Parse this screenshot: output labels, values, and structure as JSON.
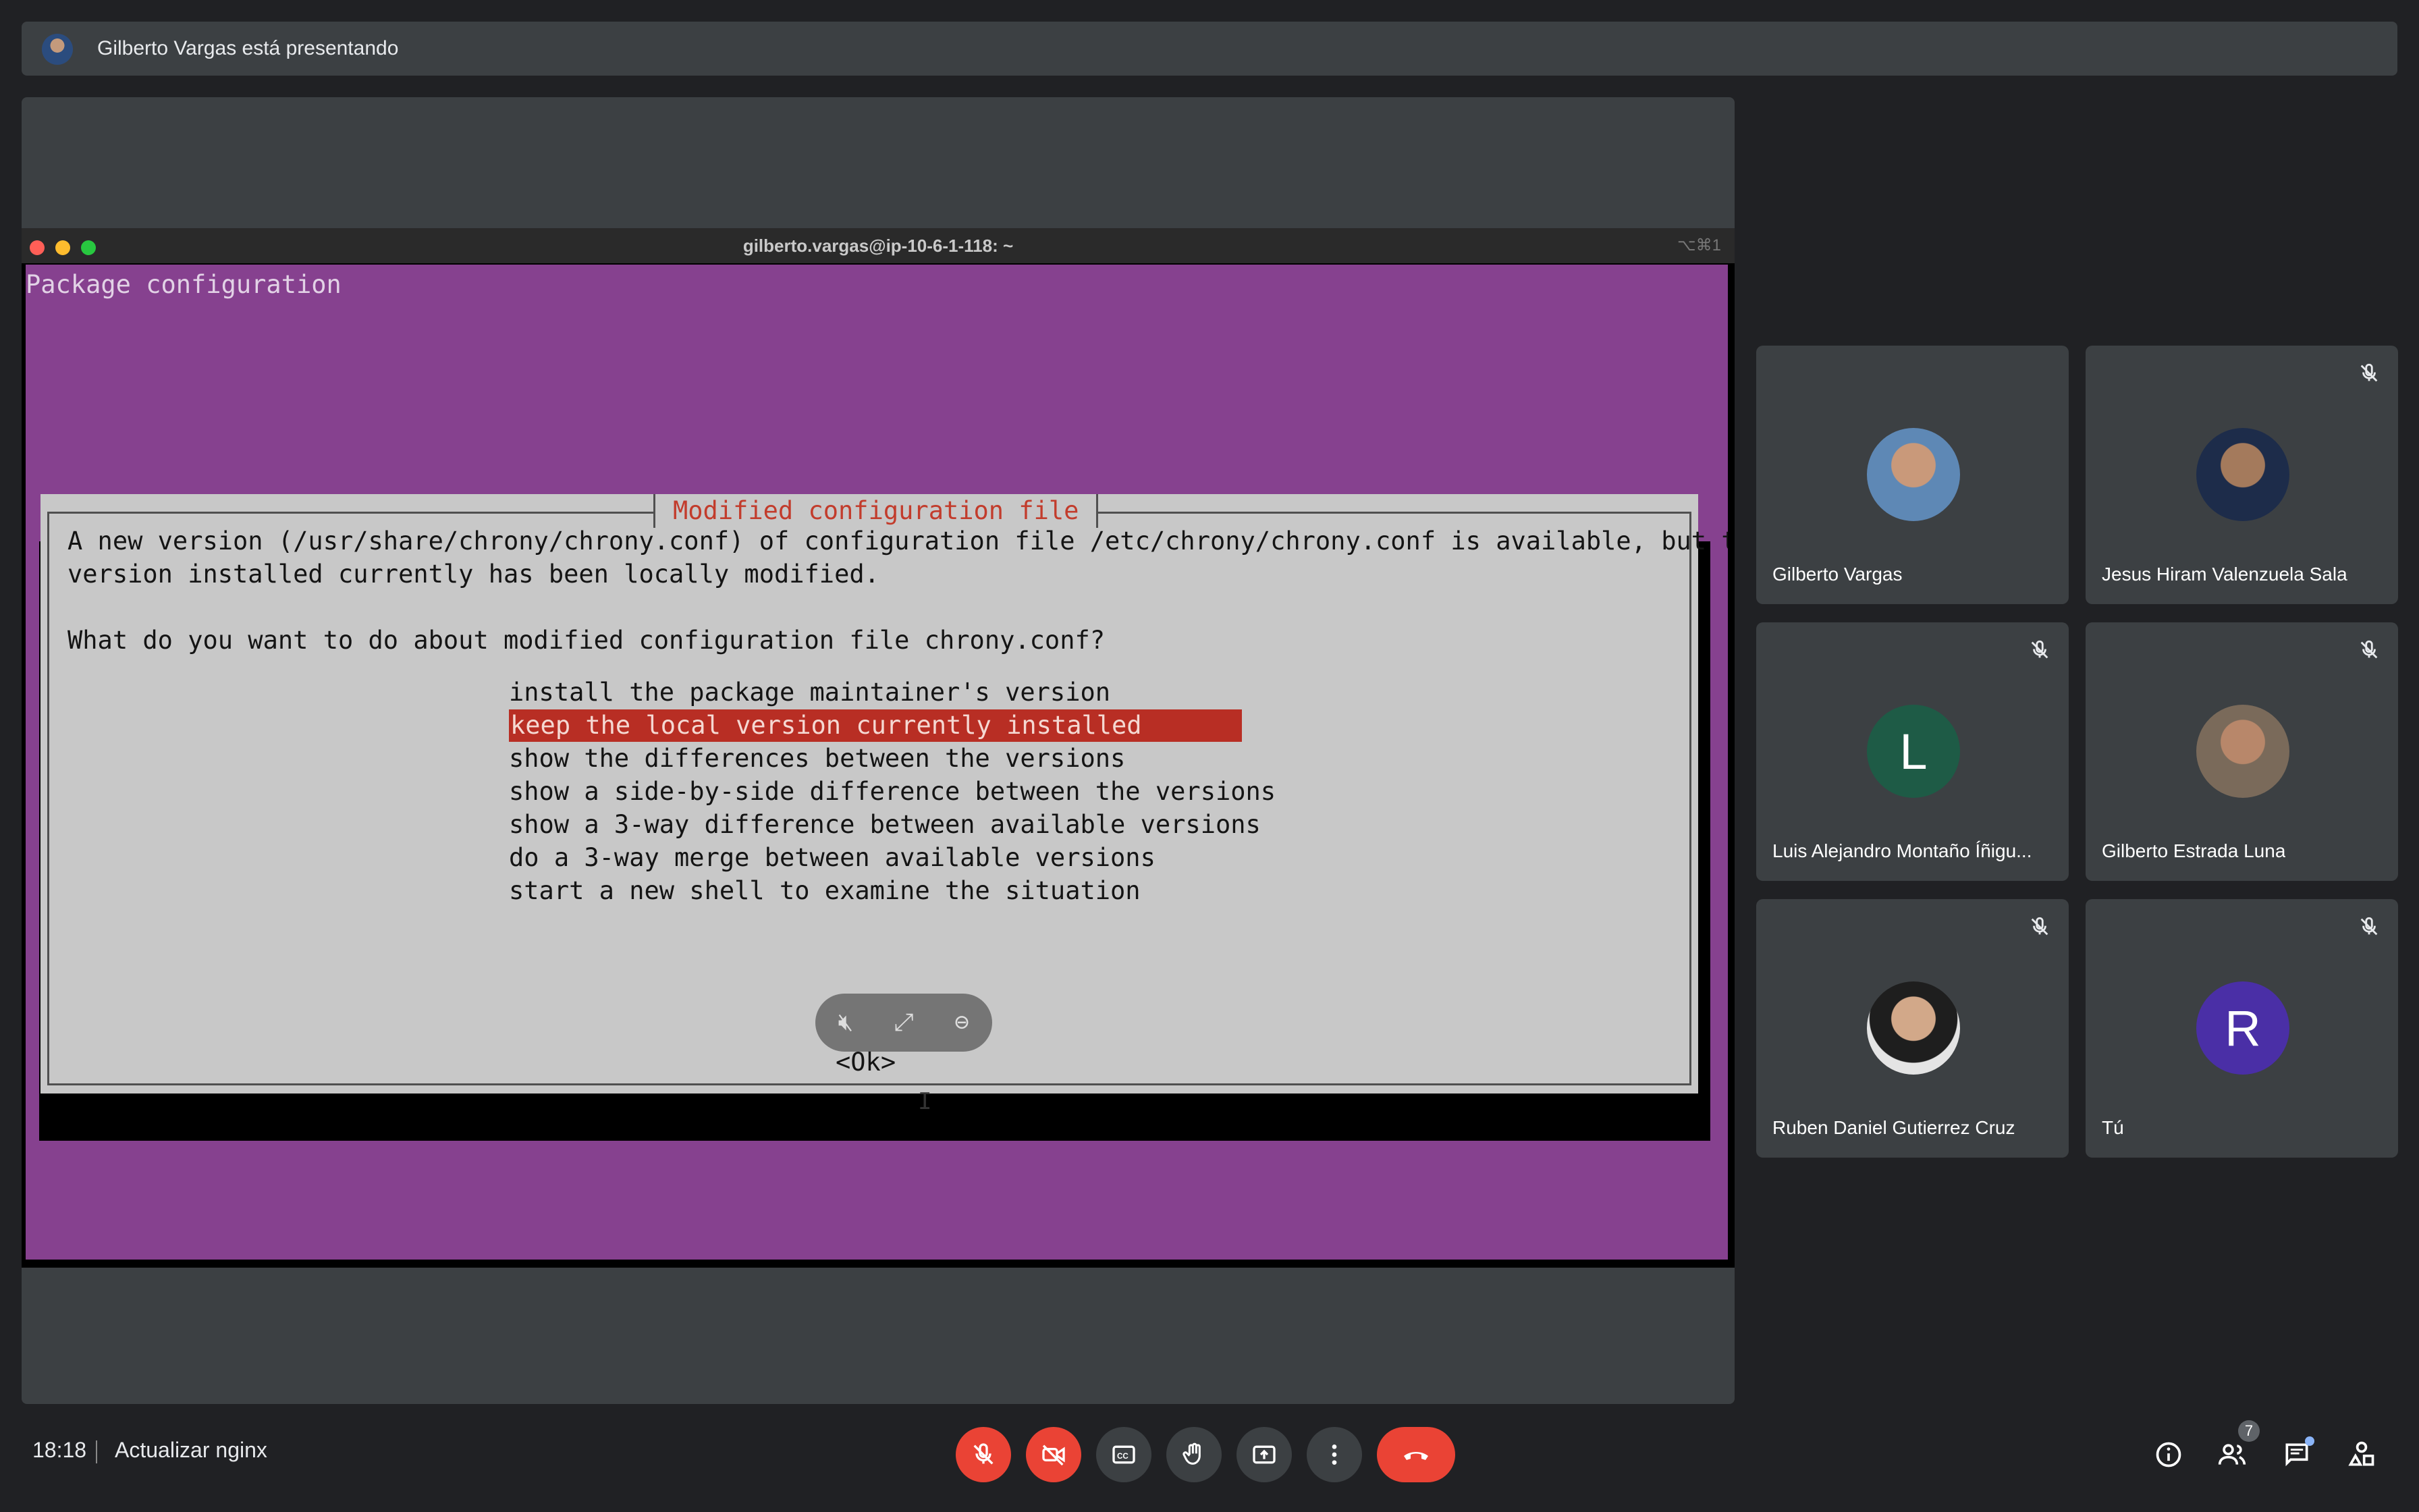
{
  "banner": {
    "text": "Gilberto Vargas está presentando"
  },
  "terminal": {
    "window_title": "gilberto.vargas@ip-10-6-1-118: ~",
    "shortcut": "⌥⌘1",
    "header": "Package configuration",
    "dialog": {
      "title": "Modified configuration file",
      "line1": "A new version (/usr/share/chrony/chrony.conf) of configuration file /etc/chrony/chrony.conf is available, but the",
      "line2": "version installed currently has been locally modified.",
      "question": "What do you want to do about modified configuration file chrony.conf?",
      "options": [
        "install the package maintainer's version",
        "keep the local version currently installed",
        "show the differences between the versions",
        "show a side-by-side difference between the versions",
        "show a 3-way difference between available versions",
        "do a 3-way merge between available versions",
        "start a new shell to examine the situation"
      ],
      "selected_index": 1,
      "ok_label": "<Ok>"
    }
  },
  "participants": [
    {
      "name": "Gilberto Vargas",
      "avatar": "photo",
      "muted": false
    },
    {
      "name": "Jesus Hiram Valenzuela Sala",
      "avatar": "photo",
      "muted": true
    },
    {
      "name": "Luis Alejandro Montaño Íñigu...",
      "avatar_letter": "L",
      "avatar_color": "#1e5b46",
      "muted": true
    },
    {
      "name": "Gilberto Estrada Luna",
      "avatar": "photo",
      "muted": true
    },
    {
      "name": "Ruben Daniel Gutierrez Cruz",
      "avatar": "photo",
      "muted": true
    },
    {
      "name": "Tú",
      "avatar_letter": "R",
      "avatar_color": "#4a2fa6",
      "muted": true
    }
  ],
  "bottom": {
    "time": "18:18",
    "meeting_name": "Actualizar nginx",
    "participant_count": "7"
  },
  "colors": {
    "end_call": "#ea4335",
    "terminal_bg": "#86418f",
    "selection": "#b82e24"
  }
}
